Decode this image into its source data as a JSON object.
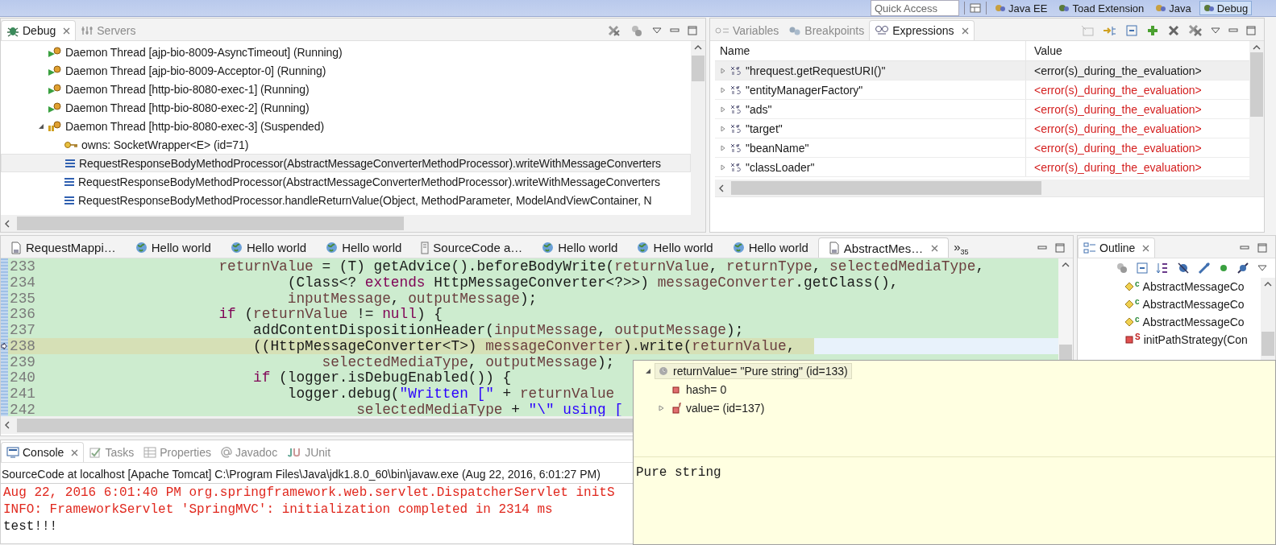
{
  "toolbar": {
    "quick_access": {
      "placeholder": "Quick Access"
    },
    "perspectives": [
      {
        "label": "Java EE",
        "selected": false
      },
      {
        "label": "Toad Extension",
        "selected": false
      },
      {
        "label": "Java",
        "selected": false
      },
      {
        "label": "Debug",
        "selected": true
      }
    ]
  },
  "debug_view": {
    "tabs": [
      {
        "label": "Debug",
        "selected": true
      },
      {
        "label": "Servers",
        "selected": false
      }
    ],
    "tree": [
      {
        "kind": "thread",
        "label": "Daemon Thread [ajp-bio-8009-AsyncTimeout] (Running)",
        "suspended": false,
        "selected": false
      },
      {
        "kind": "thread",
        "label": "Daemon Thread [ajp-bio-8009-Acceptor-0] (Running)",
        "suspended": false,
        "selected": false
      },
      {
        "kind": "thread",
        "label": "Daemon Thread [http-bio-8080-exec-1] (Running)",
        "suspended": false,
        "selected": false
      },
      {
        "kind": "thread",
        "label": "Daemon Thread [http-bio-8080-exec-2] (Running)",
        "suspended": false,
        "selected": false
      },
      {
        "kind": "thread",
        "label": "Daemon Thread [http-bio-8080-exec-3] (Suspended)",
        "suspended": true,
        "expanded": true,
        "selected": false,
        "children": [
          {
            "kind": "monitor",
            "label": "owns: SocketWrapper<E>  (id=71)",
            "selected": false
          },
          {
            "kind": "frame",
            "label": "RequestResponseBodyMethodProcessor(AbstractMessageConverterMethodProcessor).writeWithMessageConverters",
            "selected": true
          },
          {
            "kind": "frame",
            "label": "RequestResponseBodyMethodProcessor(AbstractMessageConverterMethodProcessor).writeWithMessageConverters",
            "selected": false
          },
          {
            "kind": "frame",
            "label": "RequestResponseBodyMethodProcessor.handleReturnValue(Object, MethodParameter, ModelAndViewContainer, N",
            "selected": false
          }
        ]
      }
    ]
  },
  "expressions_view": {
    "tabs": [
      {
        "label": "Variables",
        "kind": "variables",
        "selected": false
      },
      {
        "label": "Breakpoints",
        "kind": "breakpoints",
        "selected": false
      },
      {
        "label": "Expressions",
        "kind": "expressions",
        "selected": true
      }
    ],
    "columns": [
      "Name",
      "Value"
    ],
    "rows": [
      {
        "name": "\"hrequest.getRequestURI()\"",
        "value": "<error(s)_during_the_evaluation>",
        "selected": true
      },
      {
        "name": "\"entityManagerFactory\"",
        "value": "<error(s)_during_the_evaluation>",
        "selected": false
      },
      {
        "name": "\"ads\"",
        "value": "<error(s)_during_the_evaluation>",
        "selected": false
      },
      {
        "name": "\"target\"",
        "value": "<error(s)_during_the_evaluation>",
        "selected": false
      },
      {
        "name": "\"beanName\"",
        "value": "<error(s)_during_the_evaluation>",
        "selected": false
      },
      {
        "name": "\"classLoader\"",
        "value": "<error(s)_during_the_evaluation>",
        "selected": false
      }
    ]
  },
  "editor": {
    "tabs": [
      {
        "label": "RequestMappi…",
        "kind": "class",
        "selected": false
      },
      {
        "label": "Hello world",
        "kind": "browser",
        "selected": false
      },
      {
        "label": "Hello world",
        "kind": "browser",
        "selected": false
      },
      {
        "label": "Hello world",
        "kind": "browser",
        "selected": false
      },
      {
        "label": "SourceCode a…",
        "kind": "launch",
        "selected": false
      },
      {
        "label": "Hello world",
        "kind": "browser",
        "selected": false
      },
      {
        "label": "Hello world",
        "kind": "browser",
        "selected": false
      },
      {
        "label": "Hello world",
        "kind": "browser",
        "selected": false
      },
      {
        "label": "AbstractMes…",
        "kind": "class",
        "selected": true
      }
    ],
    "overflow": {
      "symbol": "»",
      "count": "35"
    },
    "lines": [
      {
        "number": "233",
        "current": false,
        "segments": [
          {
            "text": "                    returnValue",
            "kind": "local"
          },
          {
            "text": " = (T) getAdvice().beforeBodyWrite(",
            "kind": "plain"
          },
          {
            "text": "returnValue",
            "kind": "local"
          },
          {
            "text": ", ",
            "kind": "plain"
          },
          {
            "text": "returnType",
            "kind": "local"
          },
          {
            "text": ", ",
            "kind": "plain"
          },
          {
            "text": "selectedMediaType",
            "kind": "local"
          },
          {
            "text": ",",
            "kind": "plain"
          }
        ]
      },
      {
        "number": "234",
        "current": false,
        "segments": [
          {
            "text": "                            (Class<? ",
            "kind": "plain"
          },
          {
            "text": "extends",
            "kind": "keyword"
          },
          {
            "text": " HttpMessageConverter<?>>) ",
            "kind": "plain"
          },
          {
            "text": "messageConverter",
            "kind": "local"
          },
          {
            "text": ".getClass(),",
            "kind": "plain"
          }
        ]
      },
      {
        "number": "235",
        "current": false,
        "segments": [
          {
            "text": "                            inputMessage",
            "kind": "local"
          },
          {
            "text": ", ",
            "kind": "plain"
          },
          {
            "text": "outputMessage",
            "kind": "local"
          },
          {
            "text": ");",
            "kind": "plain"
          }
        ]
      },
      {
        "number": "236",
        "current": false,
        "segments": [
          {
            "text": "                    if",
            "kind": "keyword"
          },
          {
            "text": " (",
            "kind": "plain"
          },
          {
            "text": "returnValue",
            "kind": "local"
          },
          {
            "text": " != ",
            "kind": "plain"
          },
          {
            "text": "null",
            "kind": "keyword"
          },
          {
            "text": ") {",
            "kind": "plain"
          }
        ]
      },
      {
        "number": "237",
        "current": false,
        "segments": [
          {
            "text": "                        addContentDispositionHeader(",
            "kind": "plain"
          },
          {
            "text": "inputMessage",
            "kind": "local"
          },
          {
            "text": ", ",
            "kind": "plain"
          },
          {
            "text": "outputMessage",
            "kind": "local"
          },
          {
            "text": ");",
            "kind": "plain"
          }
        ]
      },
      {
        "number": "238",
        "current": true,
        "segments": [
          {
            "text": "                        ((HttpMessageConverter<T>) ",
            "kind": "plain"
          },
          {
            "text": "messageConverter",
            "kind": "local"
          },
          {
            "text": ").write(",
            "kind": "plain"
          },
          {
            "text": "returnValue",
            "kind": "local"
          },
          {
            "text": ",",
            "kind": "plain"
          }
        ]
      },
      {
        "number": "239",
        "current": false,
        "segments": [
          {
            "text": "                                selectedMediaType",
            "kind": "local"
          },
          {
            "text": ", ",
            "kind": "plain"
          },
          {
            "text": "outputMessage",
            "kind": "local"
          },
          {
            "text": ");",
            "kind": "plain"
          }
        ]
      },
      {
        "number": "240",
        "current": false,
        "segments": [
          {
            "text": "                        if",
            "kind": "keyword"
          },
          {
            "text": " (logger.isDebugEnabled()) {",
            "kind": "plain"
          }
        ]
      },
      {
        "number": "241",
        "current": false,
        "segments": [
          {
            "text": "                            logger.debug(",
            "kind": "plain"
          },
          {
            "text": "\"Written [\"",
            "kind": "string"
          },
          {
            "text": " + ",
            "kind": "plain"
          },
          {
            "text": "returnValue",
            "kind": "local"
          }
        ]
      },
      {
        "number": "242",
        "current": false,
        "segments": [
          {
            "text": "                                    selectedMediaType",
            "kind": "local"
          },
          {
            "text": " + ",
            "kind": "plain"
          },
          {
            "text": "\"\\\" using [",
            "kind": "string"
          }
        ]
      }
    ]
  },
  "outline_view": {
    "tabs": [
      {
        "label": "Outline",
        "selected": true
      }
    ],
    "items": [
      {
        "kind": "constructor",
        "decoration": "c",
        "label": "AbstractMessageCo"
      },
      {
        "kind": "constructor",
        "decoration": "c",
        "label": "AbstractMessageCo"
      },
      {
        "kind": "constructor",
        "decoration": "c",
        "label": "AbstractMessageCo"
      },
      {
        "kind": "static_method",
        "decoration": "S",
        "label": "initPathStrategy(Con"
      }
    ]
  },
  "console_view": {
    "tabs": [
      {
        "label": "Console",
        "kind": "console",
        "selected": true
      },
      {
        "label": "Tasks",
        "kind": "tasks",
        "selected": false
      },
      {
        "label": "Properties",
        "kind": "properties",
        "selected": false
      },
      {
        "label": "Javadoc",
        "kind": "javadoc",
        "selected": false
      },
      {
        "label": "JUnit",
        "kind": "junit",
        "selected": false
      }
    ],
    "header": "SourceCode at localhost [Apache Tomcat] C:\\Program Files\\Java\\jdk1.8.0_60\\bin\\javaw.exe (Aug 22, 2016, 6:01:27 PM)",
    "lines": [
      {
        "text": "Aug 22, 2016 6:01:40 PM org.springframework.web.servlet.DispatcherServlet initS",
        "kind": "error"
      },
      {
        "text": "INFO: FrameworkServlet 'SpringMVC': initialization completed in 2314 ms",
        "kind": "error"
      },
      {
        "text": "test!!!",
        "kind": "out"
      }
    ]
  },
  "hover_popup": {
    "tree": [
      {
        "label": "returnValue= \"Pure string\" (id=133)",
        "kind": "object",
        "expanded": true,
        "selected": true,
        "children": [
          {
            "label": "hash= 0",
            "kind": "field",
            "selected": false
          },
          {
            "label": "value= (id=137)",
            "kind": "final_field",
            "expanded": false,
            "selected": false
          }
        ]
      }
    ],
    "detail": "Pure string"
  }
}
